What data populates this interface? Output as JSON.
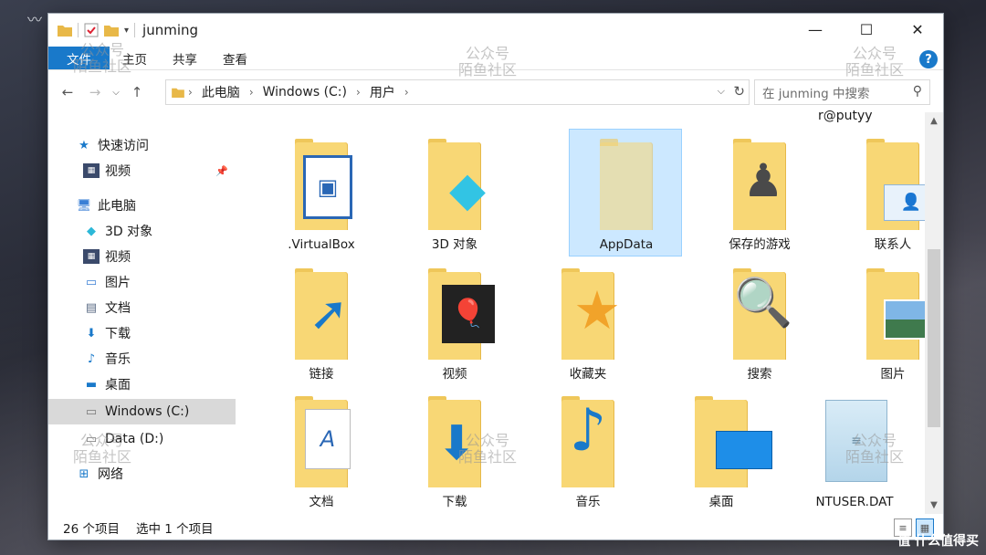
{
  "window": {
    "title": "junming",
    "controls": {
      "minimize": "—",
      "maximize": "☐",
      "close": "✕"
    }
  },
  "ribbon": {
    "tabs": [
      "文件",
      "主页",
      "共享",
      "查看"
    ],
    "help": "?"
  },
  "address": {
    "crumbs": [
      "此电脑",
      "Windows (C:)",
      "用户"
    ],
    "dropdown": "⌵",
    "refresh": "↻"
  },
  "search": {
    "placeholder": "在 junming 中搜索"
  },
  "top_partial_text": "r@putyy",
  "nav_items": [
    {
      "label": "快速访问",
      "icon": "star-icon"
    },
    {
      "label": "视频",
      "icon": "video-icon"
    },
    {
      "label": "此电脑",
      "icon": "computer-icon"
    },
    {
      "label": "3D 对象",
      "icon": "cube-icon"
    },
    {
      "label": "视频",
      "icon": "video-icon"
    },
    {
      "label": "图片",
      "icon": "image-icon"
    },
    {
      "label": "文档",
      "icon": "document-icon"
    },
    {
      "label": "下载",
      "icon": "download-icon"
    },
    {
      "label": "音乐",
      "icon": "music-icon"
    },
    {
      "label": "桌面",
      "icon": "desktop-icon"
    },
    {
      "label": "Windows (C:)",
      "icon": "drive-icon",
      "selected": true
    },
    {
      "label": "Data (D:)",
      "icon": "drive-icon"
    },
    {
      "label": "网络",
      "icon": "network-icon"
    }
  ],
  "items": [
    {
      "label": ".VirtualBox",
      "icon": "virtualbox-icon"
    },
    {
      "label": "3D 对象",
      "icon": "cube-icon"
    },
    {
      "label": "AppData",
      "icon": "folder-icon",
      "selected": true
    },
    {
      "label": "保存的游戏",
      "icon": "chess-icon"
    },
    {
      "label": "联系人",
      "icon": "contact-card-icon"
    },
    {
      "label": "链接",
      "icon": "link-arrow-icon"
    },
    {
      "label": "视频",
      "icon": "film-icon"
    },
    {
      "label": "收藏夹",
      "icon": "star-icon"
    },
    {
      "label": "搜索",
      "icon": "magnifier-icon"
    },
    {
      "label": "图片",
      "icon": "landscape-icon"
    },
    {
      "label": "文档",
      "icon": "document-icon"
    },
    {
      "label": "下载",
      "icon": "download-arrow-icon"
    },
    {
      "label": "音乐",
      "icon": "music-note-icon"
    },
    {
      "label": "桌面",
      "icon": "desktop-screen-icon"
    },
    {
      "label": "NTUSER.DAT",
      "icon": "notepad-icon"
    }
  ],
  "status": {
    "count": "26 个项目",
    "selection": "选中 1 个项目"
  },
  "watermark": {
    "line1": "公众号",
    "line2": "陌鱼社区",
    "logo": "值 什么值得买"
  },
  "colors": {
    "accent": "#1979ca",
    "selection": "#cce8ff",
    "folder": "#f8d775"
  }
}
